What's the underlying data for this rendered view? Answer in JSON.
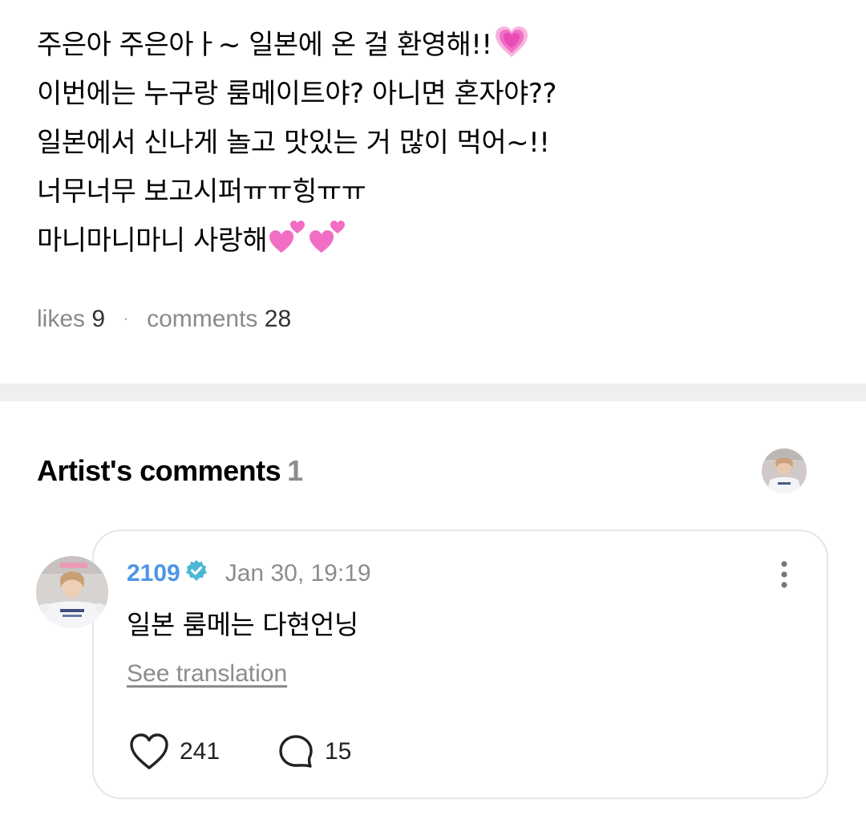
{
  "post": {
    "lines": [
      "주은아 주은아ㅏ~ 일본에 온 걸 환영해!!",
      "이번에는 누구랑 룸메이트야? 아니면 혼자야??",
      "일본에서 신나게 놀고 맛있는 거 많이 먹어~!!",
      "너무너무 보고시퍼ㅠㅠ힝ㅠㅠ",
      "마니마니마니 사랑해"
    ],
    "emoji": [
      "growing-heart",
      "two-hearts",
      "two-hearts"
    ],
    "likes_label": "likes",
    "likes_count": "9",
    "comments_label": "comments",
    "comments_count": "28"
  },
  "artist_comments": {
    "title": "Artist's comments",
    "count": "1"
  },
  "comment": {
    "author": "2109",
    "timestamp": "Jan 30, 19:19",
    "text": "일본 룸메는 다현언닝",
    "see_translation": "See translation",
    "like_count": "241",
    "reply_count": "15"
  },
  "colors": {
    "author_accent": "#4d96e8",
    "verified_badge": "#4db8d6",
    "muted_text": "#8c8c8c",
    "divider": "#efefef",
    "heart_pink": "#f26ec4"
  }
}
